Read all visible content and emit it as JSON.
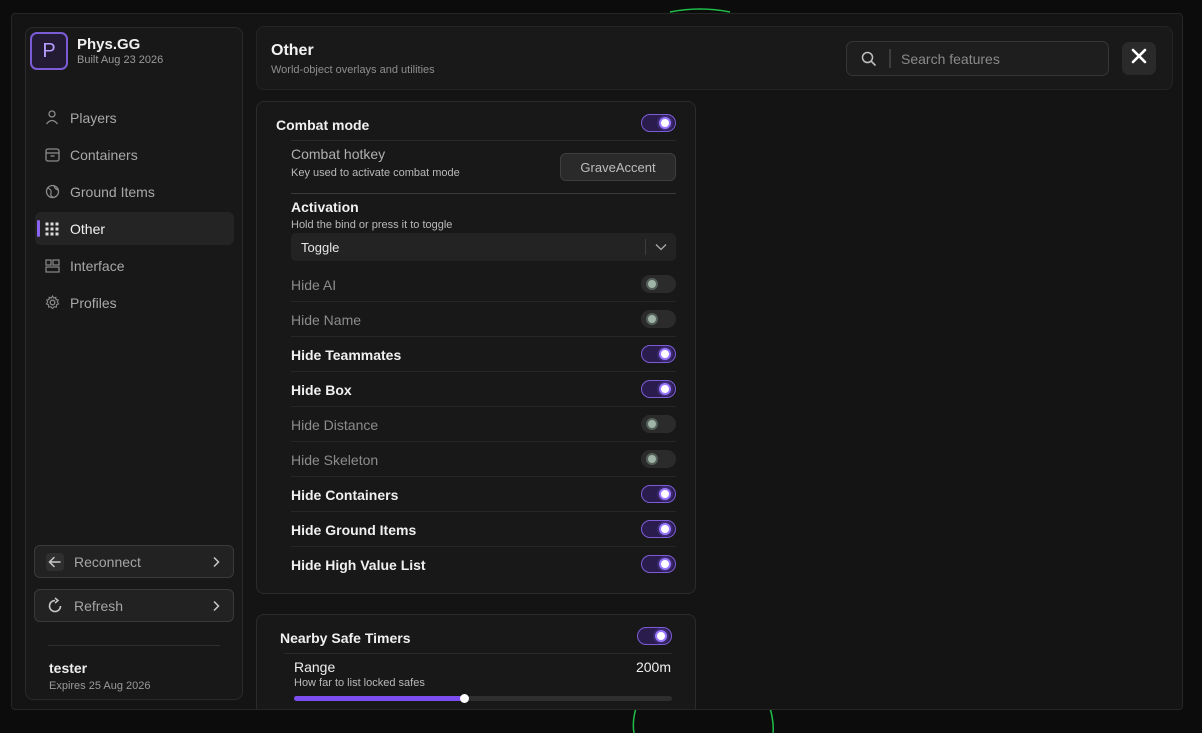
{
  "brand": {
    "logo_letter": "P",
    "name": "Phys.GG",
    "build": "Built Aug 23 2026"
  },
  "nav": {
    "items": [
      {
        "label": "Players",
        "icon": "person-icon",
        "active": false
      },
      {
        "label": "Containers",
        "icon": "box-icon",
        "active": false
      },
      {
        "label": "Ground Items",
        "icon": "globe-icon",
        "active": false
      },
      {
        "label": "Other",
        "icon": "grid-icon",
        "active": true
      },
      {
        "label": "Interface",
        "icon": "layout-icon",
        "active": false
      },
      {
        "label": "Profiles",
        "icon": "gear-icon",
        "active": false
      }
    ]
  },
  "actions": {
    "reconnect_label": "Reconnect",
    "refresh_label": "Refresh"
  },
  "user": {
    "name": "tester",
    "expires": "Expires 25 Aug 2026"
  },
  "header": {
    "title": "Other",
    "subtitle": "World-object overlays and utilities",
    "search_placeholder": "Search features"
  },
  "combat": {
    "title": "Combat mode",
    "enabled": true,
    "hotkey_label": "Combat hotkey",
    "hotkey_desc": "Key used to activate combat mode",
    "hotkey_value": "GraveAccent",
    "activation_label": "Activation",
    "activation_desc": "Hold the bind or press it to toggle",
    "activation_value": "Toggle",
    "options": [
      {
        "label": "Hide AI",
        "on": false
      },
      {
        "label": "Hide Name",
        "on": false
      },
      {
        "label": "Hide Teammates",
        "on": true
      },
      {
        "label": "Hide Box",
        "on": true
      },
      {
        "label": "Hide Distance",
        "on": false
      },
      {
        "label": "Hide Skeleton",
        "on": false
      },
      {
        "label": "Hide Containers",
        "on": true
      },
      {
        "label": "Hide Ground Items",
        "on": true
      },
      {
        "label": "Hide High Value List",
        "on": true
      }
    ]
  },
  "safe_timers": {
    "title": "Nearby Safe Timers",
    "enabled": true,
    "range_label": "Range",
    "range_value": "200m",
    "range_desc": "How far to list locked safes",
    "range_fraction": 0.45
  },
  "colors": {
    "accent": "#7c5cd6",
    "accent_bright": "#8a63f0",
    "background": "#141414"
  }
}
